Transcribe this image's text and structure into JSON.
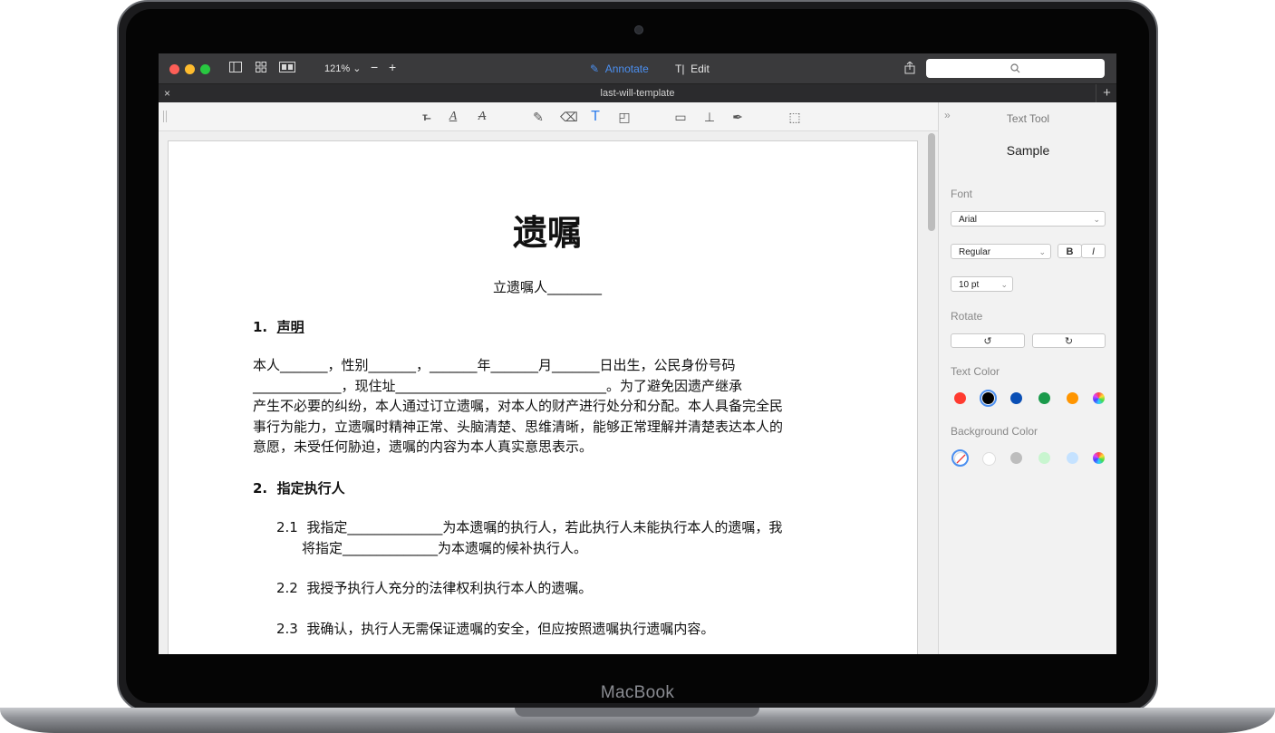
{
  "device": {
    "brand_label": "MacBook"
  },
  "window": {
    "zoom": "121%",
    "annotate_label": "Annotate",
    "edit_label": "Edit",
    "tab_title": "last-will-template"
  },
  "colors": {
    "accent": "#4b8ff0",
    "close": "#fe5f57",
    "minimize": "#febc2e",
    "zoom": "#28c840"
  },
  "document": {
    "title": "遗嘱",
    "subtitle": "立遗嘱人________",
    "section1": {
      "number": "1.",
      "heading": "声明"
    },
    "para1": [
      "本人_______，性别_______，_______年_______月_______日出生，公民身份号码",
      "_____________，现住址_______________________________。为了避免因遗产继承",
      "产生不必要的纠纷，本人通过订立遗嘱，对本人的财产进行处分和分配。本人具备完全民",
      "事行为能力，立遗嘱时精神正常、头脑清楚、思维清晰，能够正常理解并清楚表达本人的",
      "意愿，未受任何胁迫，遗嘱的内容为本人真实意思表示。"
    ],
    "section2": {
      "number": "2.",
      "heading": "指定执行人"
    },
    "item21": {
      "number": "2.1",
      "line1": "我指定______________为本遗嘱的执行人，若此执行人未能执行本人的遗嘱，我",
      "line2": "将指定______________为本遗嘱的候补执行人。"
    },
    "item22": {
      "number": "2.2",
      "text": "我授予执行人充分的法律权利执行本人的遗嘱。"
    },
    "item23": {
      "number": "2.3",
      "text": "我确认，执行人无需保证遗嘱的安全，但应按照遗嘱执行遗嘱内容。"
    }
  },
  "panel": {
    "title": "Text Tool",
    "sample": "Sample",
    "font_label": "Font",
    "font_value": "Arial",
    "style_value": "Regular",
    "bold_label": "B",
    "italic_label": "I",
    "size_value": "10 pt",
    "rotate_label": "Rotate",
    "text_color_label": "Text Color",
    "text_colors": [
      "#ff3b30",
      "#000000",
      "#0a4fb5",
      "#1a9a4b",
      "#ff9500"
    ],
    "selected_text_color": "#000000",
    "background_color_label": "Background Color",
    "background_colors": [
      "#ffffff",
      "#bdbdbd",
      "#c8f5cf",
      "#c5e2ff"
    ]
  }
}
